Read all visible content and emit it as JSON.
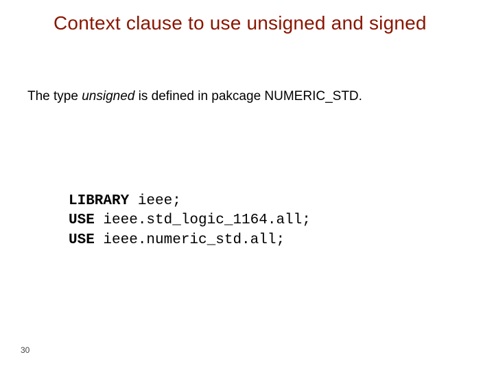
{
  "title": "Context clause to use unsigned and signed",
  "body": {
    "pre": "The type ",
    "italic": "unsigned",
    "post": " is defined in pakcage NUMERIC_STD."
  },
  "code": {
    "l1": {
      "kw": "LIBRARY",
      "rest": " ieee;"
    },
    "l2": {
      "kw": "USE",
      "rest": " ieee.std_logic_1164.all;"
    },
    "l3": {
      "kw": "USE",
      "rest": " ieee.numeric_std.all;"
    }
  },
  "page_number": "30"
}
